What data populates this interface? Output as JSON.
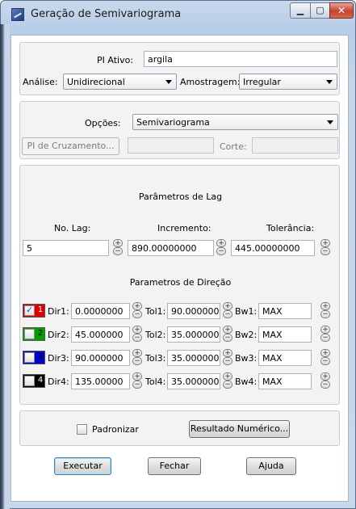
{
  "window": {
    "title": "Geração de Semivariograma"
  },
  "top": {
    "pi_label": "PI Ativo:",
    "pi_value": "argila",
    "analise_label": "Análise:",
    "analise_value": "Unidirecional",
    "amostragem_label": "Amostragem:",
    "amostragem_value": "Irregular"
  },
  "opcoes": {
    "label": "Opções:",
    "value": "Semivariograma",
    "pi_cruzamento_button": "PI de Cruzamento...",
    "corte_label": "Corte:"
  },
  "lag": {
    "title": "Parâmetros de Lag",
    "no_lag_label": "No. Lag:",
    "no_lag_value": "5",
    "incremento_label": "Incremento:",
    "incremento_value": "890.00000000",
    "tolerancia_label": "Tolerância:",
    "tolerancia_value": "445.00000000"
  },
  "direcao": {
    "title": "Parametros de Direção",
    "rows": [
      {
        "num": "1",
        "checked": true,
        "color": "#e00000",
        "dir_label": "Dir1:",
        "dir": "0.0000000",
        "tol_label": "Tol1:",
        "tol": "90.000000",
        "bw_label": "Bw1:",
        "bw": "MAX"
      },
      {
        "num": "2",
        "checked": false,
        "color": "#00a000",
        "dir_label": "Dir2:",
        "dir": "45.000000",
        "tol_label": "Tol2:",
        "tol": "35.000000",
        "bw_label": "Bw2:",
        "bw": "MAX"
      },
      {
        "num": "3",
        "checked": false,
        "color": "#0000d0",
        "dir_label": "Dir3:",
        "dir": "90.000000",
        "tol_label": "Tol3:",
        "tol": "35.000000",
        "bw_label": "Bw3:",
        "bw": "MAX"
      },
      {
        "num": "4",
        "checked": false,
        "color": "#000000",
        "dir_label": "Dir4:",
        "dir": "135.00000",
        "tol_label": "Tol4:",
        "tol": "35.000000",
        "bw_label": "Bw4:",
        "bw": "MAX"
      }
    ]
  },
  "bottom": {
    "padronizar_label": "Padronizar",
    "resultado_button": "Resultado Numérico...",
    "executar_button": "Executar",
    "fechar_button": "Fechar",
    "ajuda_button": "Ajuda"
  },
  "icons": {
    "spin_up": "+",
    "spin_down": "−",
    "close": "✕",
    "minimize": "▁",
    "maximize": "▢",
    "check": "✓"
  }
}
